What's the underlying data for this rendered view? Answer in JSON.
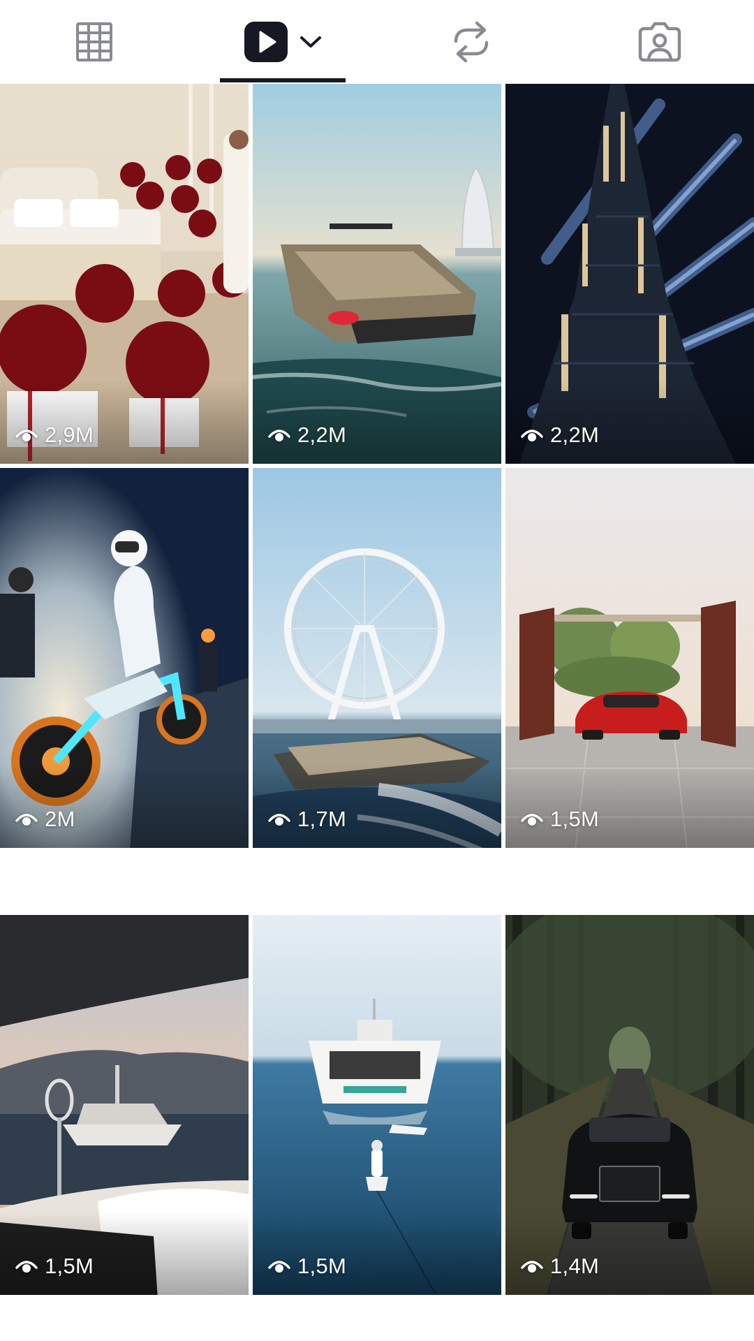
{
  "tabs": [
    {
      "name": "grid-icon",
      "active": false
    },
    {
      "name": "reels-play-icon",
      "active": true
    },
    {
      "name": "repost-icon",
      "active": false
    },
    {
      "name": "tagged-icon",
      "active": false
    }
  ],
  "colors": {
    "icon_inactive": "#8a8b91",
    "icon_active": "#161823",
    "underline": "#161823"
  },
  "videos": [
    {
      "views": "2,9M",
      "scene": "bedroom with red roses"
    },
    {
      "views": "2,2M",
      "scene": "gold yacht near burj al arab"
    },
    {
      "views": "2,2M",
      "scene": "burj khalifa with light beams"
    },
    {
      "views": "2M",
      "scene": "glowing motorcycle at night"
    },
    {
      "views": "1,7M",
      "scene": "yacht passing ferris wheel"
    },
    {
      "views": "1,5M",
      "scene": "red supercar at gate"
    },
    {
      "views": "1,5M",
      "scene": "superyacht at sunset from boat"
    },
    {
      "views": "1,5M",
      "scene": "catamaran yacht with jet ski"
    },
    {
      "views": "1,4M",
      "scene": "black luxury car on forest road"
    }
  ]
}
